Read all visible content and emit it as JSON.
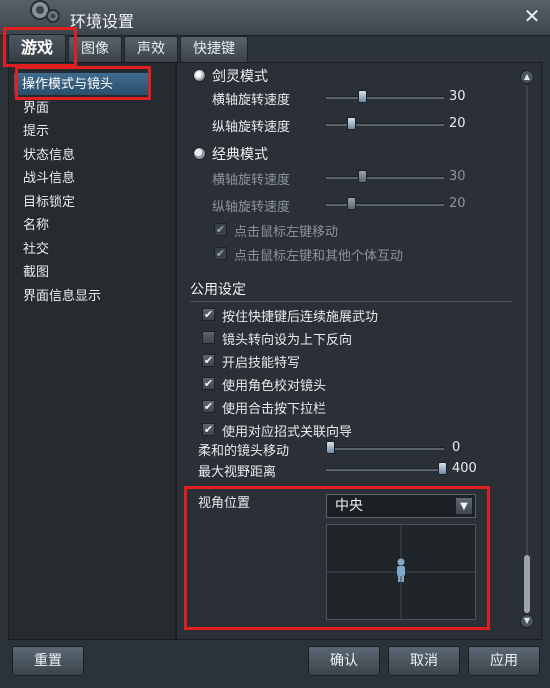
{
  "window": {
    "title": "环境设置"
  },
  "tabs": [
    "游戏",
    "图像",
    "声效",
    "快捷键"
  ],
  "sidebar": {
    "items": [
      "操作模式与镜头",
      "界面",
      "提示",
      "状态信息",
      "战斗信息",
      "目标锁定",
      "名称",
      "社交",
      "截图",
      "界面信息显示"
    ]
  },
  "modes": {
    "sword": {
      "label": "剑灵模式",
      "h_label": "横轴旋转速度",
      "h_value": "30",
      "v_label": "纵轴旋转速度",
      "v_value": "20"
    },
    "classic": {
      "label": "经典模式",
      "h_label": "横轴旋转速度",
      "h_value": "30",
      "v_label": "纵轴旋转速度",
      "v_value": "20",
      "opt1": "点击鼠标左键移动",
      "opt2": "点击鼠标左键和其他个体互动"
    }
  },
  "common": {
    "title": "公用设定",
    "options": [
      {
        "label": "按住快捷键后连续施展武功",
        "checked": true
      },
      {
        "label": "镜头转向设为上下反向",
        "checked": false
      },
      {
        "label": "开启技能特写",
        "checked": true
      },
      {
        "label": "使用角色校对镜头",
        "checked": true
      },
      {
        "label": "使用合击按下拉栏",
        "checked": true
      },
      {
        "label": "使用对应招式关联向导",
        "checked": true
      }
    ],
    "smooth_label": "柔和的镜头移动",
    "smooth_value": "0",
    "fov_label": "最大视野距离",
    "fov_value": "400"
  },
  "view": {
    "label": "视角位置",
    "selected": "中央"
  },
  "buttons": {
    "reset": "重置",
    "ok": "确认",
    "cancel": "取消",
    "apply": "应用"
  }
}
